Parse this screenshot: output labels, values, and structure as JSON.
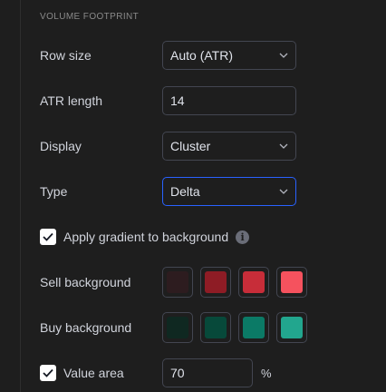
{
  "section": {
    "title": "VOLUME FOOTPRINT"
  },
  "row_size": {
    "label": "Row size",
    "value": "Auto (ATR)"
  },
  "atr_length": {
    "label": "ATR length",
    "value": "14"
  },
  "display": {
    "label": "Display",
    "value": "Cluster"
  },
  "type": {
    "label": "Type",
    "value": "Delta"
  },
  "gradient": {
    "label": "Apply gradient to background",
    "checked": true
  },
  "sell_background": {
    "label": "Sell background",
    "colors": [
      "#2d1c1f",
      "#8e1c25",
      "#c72d39",
      "#f5525e"
    ]
  },
  "buy_background": {
    "label": "Buy background",
    "colors": [
      "#0f2821",
      "#07493a",
      "#0b7a66",
      "#22a68e"
    ]
  },
  "value_area": {
    "label": "Value area",
    "checked": true,
    "value": "70",
    "unit": "%"
  },
  "colors": {
    "focus_border": "#2962ff",
    "border": "#434651",
    "background": "#1e1e1e"
  }
}
